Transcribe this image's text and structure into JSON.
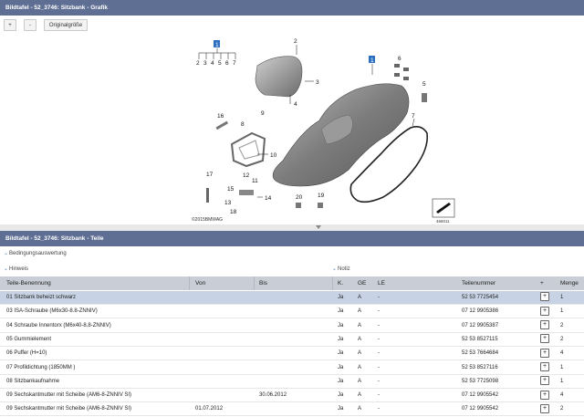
{
  "graphic_panel": {
    "title": "Bildtafel - 52_3746: Sitzbank - Grafik",
    "zoom_in_label": "+",
    "zoom_out_label": "-",
    "original_size_label": "Originalgröße"
  },
  "diagram": {
    "callouts": [
      "1",
      "2",
      "3",
      "4",
      "1",
      "6",
      "5",
      "7",
      "16",
      "8",
      "9",
      "10",
      "11",
      "12",
      "13",
      "14",
      "15",
      "17",
      "18",
      "19",
      "20"
    ],
    "group_numbers": [
      "2",
      "3",
      "4",
      "5",
      "6",
      "7"
    ],
    "copyright": "©2015BMWAG",
    "ref_number": "466011"
  },
  "parts_panel": {
    "title": "Bildtafel - 52_3746: Sitzbank - Teile",
    "filters": [
      "Bedingungsauswertung",
      "Hinweis",
      "Notiz"
    ]
  },
  "table": {
    "headers": {
      "name": "Teile-Benennung",
      "von": "Von",
      "bis": "Bis",
      "k": "K.",
      "ge": "GE",
      "le": "LE",
      "number": "Teilenummer",
      "plus": "+",
      "menge": "Menge"
    },
    "rows": [
      {
        "name": "01 Sitzbank beheizt schwarz",
        "von": "",
        "bis": "",
        "k": "Ja",
        "ge": "A",
        "le": "-",
        "number": "52 53 7725454",
        "menge": "1"
      },
      {
        "name": "03 ISA-Schraube (M6x30-8.8-ZNNIV)",
        "von": "",
        "bis": "",
        "k": "Ja",
        "ge": "A",
        "le": "-",
        "number": "07 12 9905386",
        "menge": "1"
      },
      {
        "name": "04 Schraube Innentorx (M6x40-8.8-ZNNIV)",
        "von": "",
        "bis": "",
        "k": "Ja",
        "ge": "A",
        "le": "-",
        "number": "07 12 9905387",
        "menge": "2"
      },
      {
        "name": "05 Gummielement",
        "von": "",
        "bis": "",
        "k": "Ja",
        "ge": "A",
        "le": "-",
        "number": "52 53 8527115",
        "menge": "2"
      },
      {
        "name": "06 Puffer (H=10)",
        "von": "",
        "bis": "",
        "k": "Ja",
        "ge": "A",
        "le": "-",
        "number": "52 53 7664684",
        "menge": "4"
      },
      {
        "name": "07 Profildichtung (1850MM )",
        "von": "",
        "bis": "",
        "k": "Ja",
        "ge": "A",
        "le": "-",
        "number": "52 53 8527116",
        "menge": "1"
      },
      {
        "name": "08 Sitzbankaufnahme",
        "von": "",
        "bis": "",
        "k": "Ja",
        "ge": "A",
        "le": "-",
        "number": "52 53 7725098",
        "menge": "1"
      },
      {
        "name": "09 Sechskantmutter mit Scheibe (AM6-8-ZNNIV SI)",
        "von": "",
        "bis": "30.06.2012",
        "k": "Ja",
        "ge": "A",
        "le": "-",
        "number": "07 12 9905542",
        "menge": "4"
      },
      {
        "name": "09 Sechskantmutter mit Scheibe (AM6-8-ZNNIV SI)",
        "von": "01.07.2012",
        "bis": "",
        "k": "Ja",
        "ge": "A",
        "le": "-",
        "number": "07 12 9905542",
        "menge": "2"
      }
    ]
  },
  "colors": {
    "header_bg": "#5f6f93",
    "selected_row": "#c7d3e5",
    "table_header": "#c8cdd6",
    "callout_highlight": "#2b6fc1"
  }
}
